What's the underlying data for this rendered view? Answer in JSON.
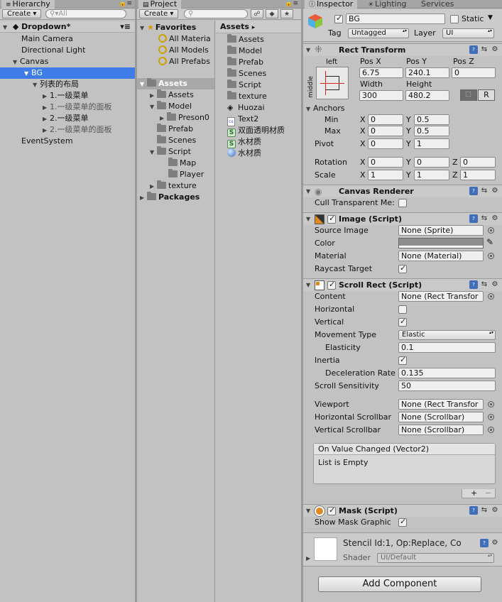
{
  "hierarchy": {
    "tab_label": "Hierarchy",
    "create_label": "Create",
    "search_placeholder": "All",
    "scene_name": "Dropdown*",
    "items": [
      {
        "label": "Main Camera"
      },
      {
        "label": "Directional Light"
      },
      {
        "label": "Canvas"
      },
      {
        "label": "BG"
      },
      {
        "label": "列表的布局"
      },
      {
        "label": "1.一级菜单"
      },
      {
        "label": "1.一级菜单的面板"
      },
      {
        "label": "2.一级菜单"
      },
      {
        "label": "2.一级菜单的面板"
      },
      {
        "label": "EventSystem"
      }
    ]
  },
  "project": {
    "tab_label": "Project",
    "create_label": "Create",
    "favorites": {
      "label": "Favorites",
      "items": [
        "All Materia",
        "All Models",
        "All Prefabs"
      ]
    },
    "tree": {
      "root": "Assets",
      "items": [
        "Assets",
        "Model",
        "Preson0",
        "Prefab",
        "Scenes",
        "Script",
        "Map",
        "Player",
        "texture"
      ],
      "packages": "Packages"
    },
    "crumb": "Assets",
    "assets": [
      "Assets",
      "Model",
      "Prefab",
      "Scenes",
      "Script",
      "texture",
      "Huozai",
      "Text2",
      "双面透明材质",
      "水材质",
      "水材质"
    ]
  },
  "inspector": {
    "tabs": [
      "Inspector",
      "Lighting",
      "Services"
    ],
    "object_name": "BG",
    "static_label": "Static",
    "tag_label": "Tag",
    "tag_value": "Untagged",
    "layer_label": "Layer",
    "layer_value": "UI",
    "rect_transform": {
      "title": "Rect Transform",
      "anchor_h": "left",
      "anchor_v": "middle",
      "pos_x_label": "Pos X",
      "pos_y_label": "Pos Y",
      "pos_z_label": "Pos Z",
      "pos_x": "6.75",
      "pos_y": "240.1",
      "pos_z": "0",
      "width_label": "Width",
      "height_label": "Height",
      "width": "300",
      "height": "480.2",
      "r_label": "R",
      "anchors_label": "Anchors",
      "min_label": "Min",
      "max_label": "Max",
      "min_x": "0",
      "min_y": "0.5",
      "max_x": "0",
      "max_y": "0.5",
      "pivot_label": "Pivot",
      "pivot_x": "0",
      "pivot_y": "1",
      "rotation_label": "Rotation",
      "rot_x": "0",
      "rot_y": "0",
      "rot_z": "0",
      "scale_label": "Scale",
      "scale_x": "1",
      "scale_y": "1",
      "scale_z": "1",
      "x": "X",
      "y": "Y",
      "z": "Z"
    },
    "canvas_renderer": {
      "title": "Canvas Renderer",
      "cull_label": "Cull Transparent Me:"
    },
    "image": {
      "title": "Image (Script)",
      "source_label": "Source Image",
      "source_value": "None (Sprite)",
      "color_label": "Color",
      "color_value": "#8e8e8e",
      "material_label": "Material",
      "material_value": "None (Material)",
      "raycast_label": "Raycast Target"
    },
    "scroll_rect": {
      "title": "Scroll Rect (Script)",
      "content_label": "Content",
      "content_value": "None (Rect Transfor",
      "horizontal_label": "Horizontal",
      "vertical_label": "Vertical",
      "movement_label": "Movement Type",
      "movement_value": "Elastic",
      "elasticity_label": "Elasticity",
      "elasticity_value": "0.1",
      "inertia_label": "Inertia",
      "decel_label": "Deceleration Rate",
      "decel_value": "0.135",
      "sensitivity_label": "Scroll Sensitivity",
      "sensitivity_value": "50",
      "viewport_label": "Viewport",
      "viewport_value": "None (Rect Transfor",
      "hscroll_label": "Horizontal Scrollbar",
      "hscroll_value": "None (Scrollbar)",
      "vscroll_label": "Vertical Scrollbar",
      "vscroll_value": "None (Scrollbar)",
      "event_title": "On Value Changed (Vector2)",
      "event_body": "List is Empty",
      "plus": "+",
      "minus": "−"
    },
    "mask": {
      "title": "Mask (Script)",
      "show_label": "Show Mask Graphic"
    },
    "material": {
      "name": "Stencil Id:1, Op:Replace, Co",
      "shader_label": "Shader",
      "shader_value": "UI/Default"
    },
    "add_component": "Add Component"
  },
  "colors": {
    "selection": "#3e7de7",
    "panel_bg": "#c2c2c2"
  }
}
